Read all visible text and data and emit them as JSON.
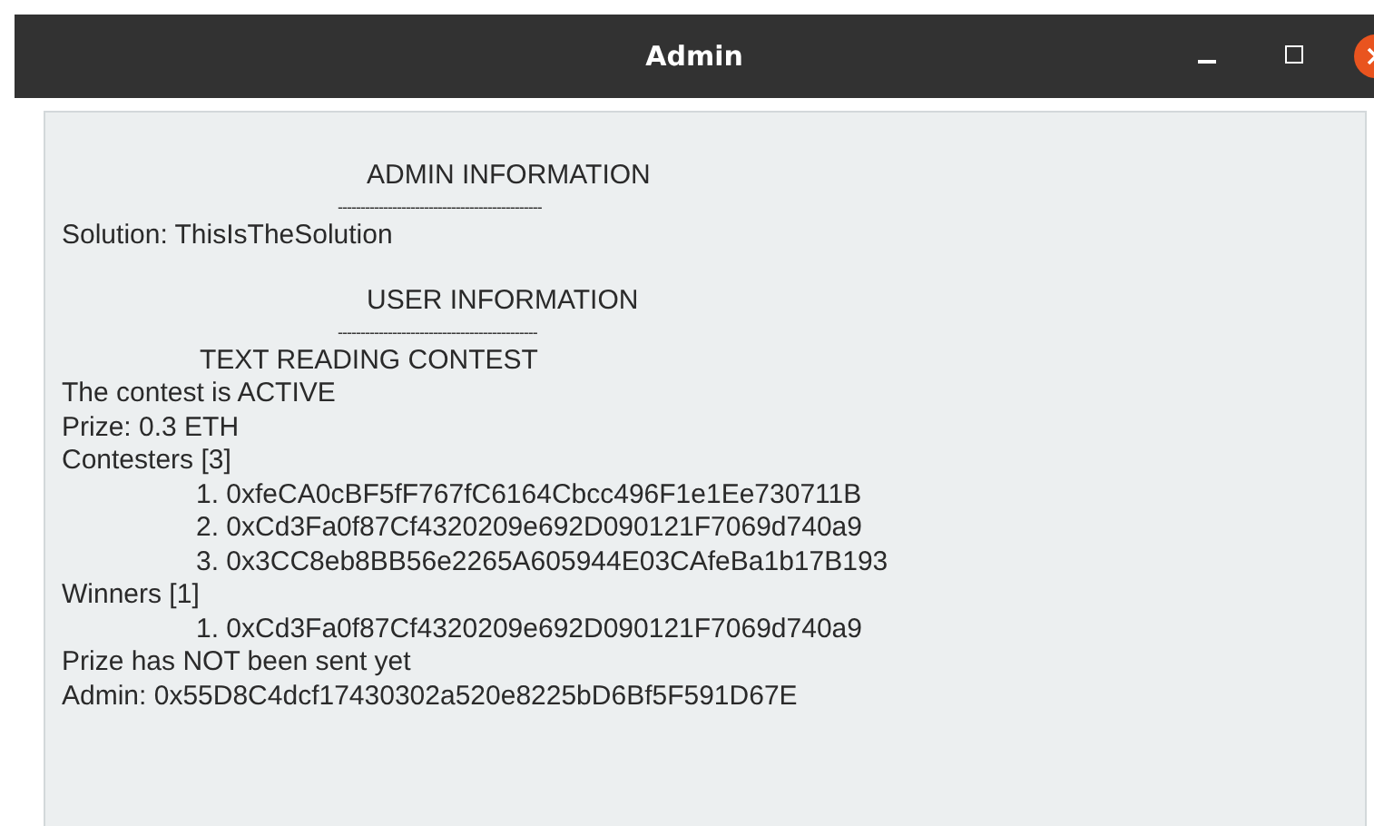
{
  "window": {
    "title": "Admin"
  },
  "lines": [
    {
      "kind": "heading",
      "text": "ADMIN INFORMATION"
    },
    {
      "kind": "rule",
      "text": "---------------------------------------------"
    },
    {
      "kind": "plain",
      "text": "Solution: ThisIsTheSolution"
    },
    {
      "kind": "heading",
      "text": "USER INFORMATION"
    },
    {
      "kind": "rule",
      "text": "--------------------------------------------"
    },
    {
      "kind": "title",
      "text": "TEXT READING CONTEST"
    },
    {
      "kind": "plain",
      "text": "The contest is ACTIVE"
    },
    {
      "kind": "plain",
      "text": "Prize: 0.3 ETH"
    },
    {
      "kind": "plain",
      "text": "Contesters [3]"
    },
    {
      "kind": "item",
      "text": "1. 0xfeCA0cBF5fF767fC6164Cbcc496F1e1Ee730711B"
    },
    {
      "kind": "item",
      "text": "2. 0xCd3Fa0f87Cf4320209e692D090121F7069d740a9"
    },
    {
      "kind": "item",
      "text": "3. 0x3CC8eb8BB56e2265A605944E03CAfeBa1b17B193"
    },
    {
      "kind": "plain",
      "text": "Winners [1]"
    },
    {
      "kind": "item",
      "text": "1. 0xCd3Fa0f87Cf4320209e692D090121F7069d740a9"
    },
    {
      "kind": "plain",
      "text": "Prize has NOT been sent yet"
    },
    {
      "kind": "plain",
      "text": "Admin: 0x55D8C4dcf17430302a520e8225bD6Bf5F591D67E"
    }
  ]
}
